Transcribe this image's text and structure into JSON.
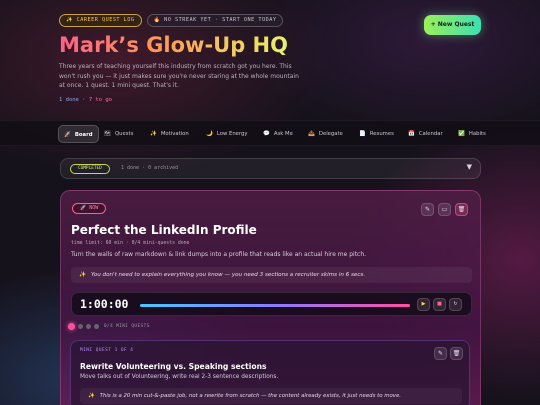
{
  "hero": {
    "badge_quest": "✨ CAREER QUEST LOG",
    "badge_streak": "🔥 NO STREAK YET · START ONE TODAY",
    "new_quest_label": "+ New Quest",
    "title": "Mark’s Glow-Up HQ",
    "subtitle": "Three years of teaching yourself this industry from scratch got you here. This won't rush you — it just makes sure you're never staring at the whole mountain at once. 1 quest. 1 mini quest. That's it.",
    "progress_done": "1 done",
    "progress_sep": " · ",
    "progress_togo": "7 to go"
  },
  "nav": {
    "items": [
      {
        "icon": "🚀",
        "label": "Board"
      },
      {
        "icon": "🗺",
        "label": "Quests"
      },
      {
        "icon": "✨",
        "label": "Motivation"
      },
      {
        "icon": "🌙",
        "label": "Low Energy"
      },
      {
        "icon": "💬",
        "label": "Ask Me"
      },
      {
        "icon": "📤",
        "label": "Delegate"
      },
      {
        "icon": "📄",
        "label": "Resumes"
      },
      {
        "icon": "📅",
        "label": "Calendar"
      },
      {
        "icon": "✅",
        "label": "Habits"
      }
    ]
  },
  "status": {
    "pill": "COMPLETED",
    "meta": "1 done · 0 archived",
    "caret": "▼"
  },
  "quest": {
    "pill": "🚀 NOW",
    "title": "Perfect the LinkedIn Profile",
    "meta": "time limit: 60 min · 0/4 mini-quests done",
    "description": "Turn the walls of raw markdown & link dumps into a profile that reads like an actual hire me pitch.",
    "tip_icon": "✨",
    "tip": "You don't need to explain everything you know — you need 3 sections a recruiter skims in 6 secs.",
    "timer": "1:00:00",
    "progress": 0,
    "mini_label": "0/4 MINI QUESTS"
  },
  "mini_quest": {
    "kicker": "MINI QUEST 1 OF 4",
    "title": "Rewrite Volunteering vs. Speaking sections",
    "description": "Move talks out of Volunteering, write real 2-3 sentence descriptions.",
    "tip_icon": "✨",
    "tip": "This is a 20 min cut-&-paste job, not a rewrite from scratch — the content already exists, it just needs to move."
  }
}
